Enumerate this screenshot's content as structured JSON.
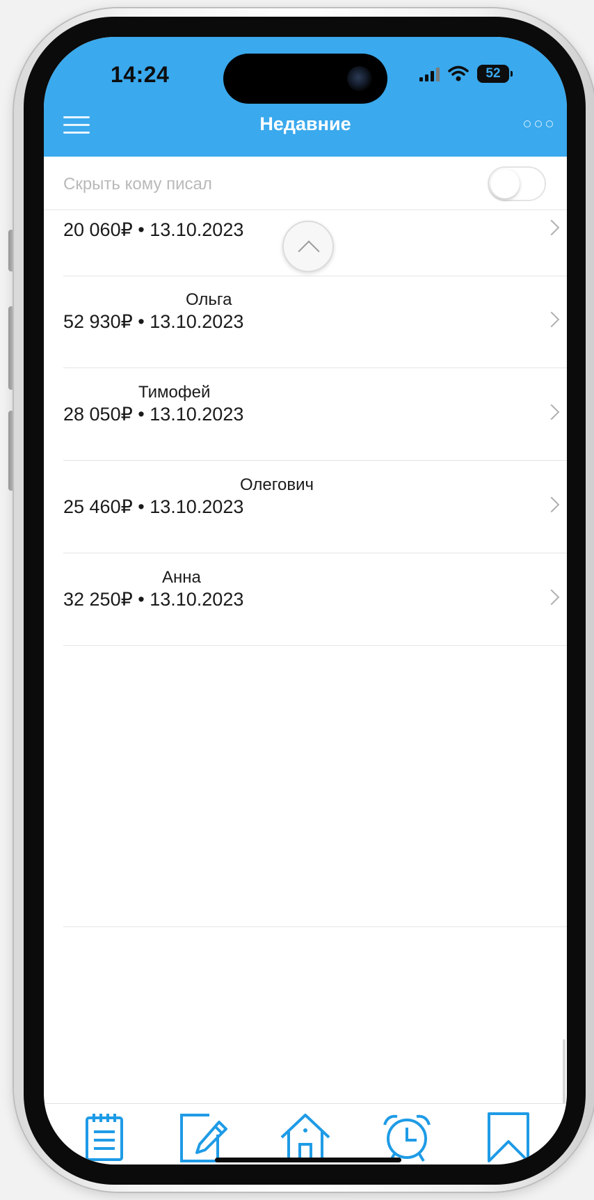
{
  "status_bar": {
    "time": "14:24",
    "battery": "52"
  },
  "nav": {
    "title": "Недавние"
  },
  "filter": {
    "label": "Скрыть кому писал",
    "hide_contacted_enabled": false
  },
  "items": [
    {
      "name": "",
      "meta": "20 060₽ • 13.10.2023"
    },
    {
      "name": "Ольга",
      "meta": "52 930₽ • 13.10.2023"
    },
    {
      "name": "Тимофей",
      "meta": "28 050₽ • 13.10.2023"
    },
    {
      "name": "Олегович",
      "meta": "25 460₽ • 13.10.2023"
    },
    {
      "name": "Анна",
      "meta": "32 250₽ • 13.10.2023"
    }
  ],
  "tabbar": {
    "tabs": [
      {
        "icon": "notepad-icon"
      },
      {
        "icon": "edit-icon"
      },
      {
        "icon": "home-icon"
      },
      {
        "icon": "alarm-clock-icon"
      },
      {
        "icon": "bookmark-icon"
      }
    ]
  },
  "colors": {
    "header": "#3aa9ed",
    "tab_icon": "#1e9be6"
  }
}
